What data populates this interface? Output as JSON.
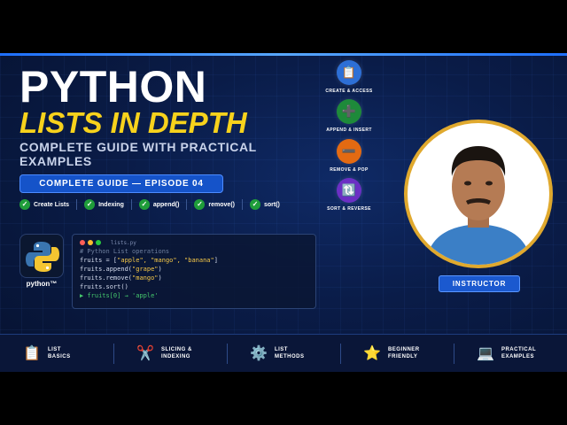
{
  "hero": {
    "title_line1": "PYTHON",
    "title_line2": "LISTS IN DEPTH",
    "subtitle": "COMPLETE GUIDE WITH PRACTICAL EXAMPLES",
    "episode_badge": "COMPLETE GUIDE — EPISODE 04"
  },
  "topics": [
    {
      "label": "Create Lists"
    },
    {
      "label": "Indexing"
    },
    {
      "label": "append()"
    },
    {
      "label": "remove()"
    },
    {
      "label": "sort()"
    }
  ],
  "python_logo": {
    "label": "python™"
  },
  "code_window": {
    "filename": "lists.py",
    "comment": "# Python List operations",
    "line1_prefix": "fruits = [",
    "line1_items": "\"apple\", \"mango\", \"banana\"",
    "line1_suffix": "]",
    "line2_prefix": "fruits.append(",
    "line2_arg": "\"grape\"",
    "line2_suffix": ")",
    "line3_prefix": "fruits.remove(",
    "line3_arg": "\"mango\"",
    "line3_suffix": ")",
    "line4": "fruits.sort()",
    "output": "▶ fruits[0] → 'apple'"
  },
  "features": [
    {
      "label": "CREATE & ACCESS",
      "icon": "clipboard-icon",
      "color": "#2d6fd6",
      "glyph": "📋"
    },
    {
      "label": "APPEND & INSERT",
      "icon": "plus-icon",
      "color": "#1e8a3a",
      "glyph": "➕"
    },
    {
      "label": "REMOVE & POP",
      "icon": "minus-icon",
      "color": "#e36a12",
      "glyph": "➖"
    },
    {
      "label": "SORT & REVERSE",
      "icon": "sort-icon",
      "color": "#6b2fc4",
      "glyph": "🔃"
    }
  ],
  "instructor": {
    "label": "INSTRUCTOR"
  },
  "bottom_bar": [
    {
      "line1": "LIST",
      "line2": "BASICS",
      "icon": "clipboard-icon",
      "glyph": "📋"
    },
    {
      "line1": "SLICING &",
      "line2": "INDEXING",
      "icon": "scissors-icon",
      "glyph": "✂️"
    },
    {
      "line1": "LIST",
      "line2": "METHODS",
      "icon": "gear-icon",
      "glyph": "⚙️"
    },
    {
      "line1": "BEGINNER",
      "line2": "FRIENDLY",
      "icon": "star-icon",
      "glyph": "⭐"
    },
    {
      "line1": "PRACTICAL",
      "line2": "EXAMPLES",
      "icon": "laptop-icon",
      "glyph": "💻"
    }
  ],
  "colors": {
    "accent_yellow": "#f7d21c",
    "accent_blue": "#1553c9",
    "background": "#0a1c48",
    "check_green": "#1f9d3a"
  }
}
